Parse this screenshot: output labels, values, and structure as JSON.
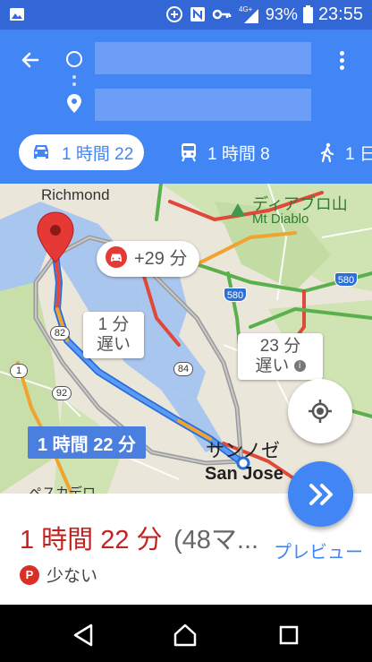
{
  "status_bar": {
    "battery_percent": "93%",
    "clock": "23:55",
    "network": "4G+"
  },
  "app_bar": {
    "back_icon": "arrow-left-icon",
    "origin_icon": "circle-icon",
    "destination_icon": "pin-icon",
    "more_icon": "more-vertical-icon"
  },
  "mode_tabs": [
    {
      "mode": "drive",
      "icon": "car-icon",
      "label": "1 時間 22"
    },
    {
      "mode": "transit",
      "icon": "train-icon",
      "label": "1 時間 8"
    },
    {
      "mode": "walk",
      "icon": "walking-icon",
      "label": "1 日"
    }
  ],
  "map": {
    "labels": {
      "richmond": "Richmond",
      "diablo_jp": "ディアブロ山",
      "diablo_en": "Mt Diablo",
      "sanjose_jp": "サンノゼ",
      "sanjose_en": "San Jose",
      "pescadero": "ペスカデロ"
    },
    "shields": {
      "s580a": "580",
      "s580b": "580",
      "s82": "82",
      "s84": "84",
      "s92": "92",
      "s1": "1"
    },
    "callouts": {
      "traffic": "+29 分",
      "alt1_line1": "1 分",
      "alt1_line2": "遅い",
      "alt2_line1": "23 分",
      "alt2_line2": "遅い"
    },
    "selected_route": "1 時間 22 分"
  },
  "bottom_sheet": {
    "travel_time": "1 時間 22 分",
    "distance": "(48マ...",
    "preview": "プレビュー",
    "parking_badge": "P",
    "parking_text": "少ない"
  },
  "colors": {
    "primary": "#4285f4",
    "status_bar": "#3367d6",
    "time_red": "#c5221f",
    "parking_red": "#d93025"
  }
}
